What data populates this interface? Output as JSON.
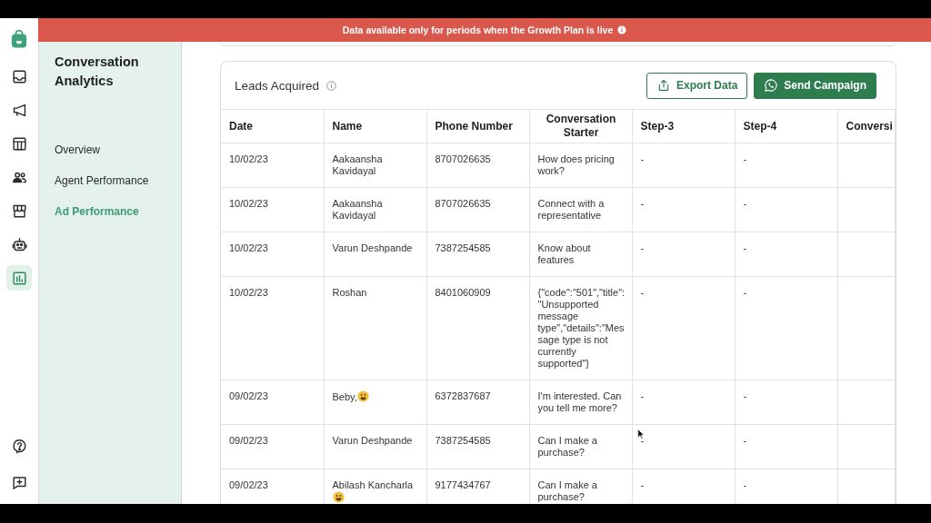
{
  "rail": {
    "items": [
      {
        "selected": false
      },
      {
        "selected": false
      },
      {
        "selected": false
      },
      {
        "selected": false
      },
      {
        "selected": false
      },
      {
        "selected": false
      },
      {
        "selected": true
      }
    ]
  },
  "banner": {
    "text": "Data available only for periods when the Growth Plan is live"
  },
  "sidebar": {
    "title": "Conversation Analytics",
    "items": [
      {
        "label": "Overview",
        "selected": false
      },
      {
        "label": "Agent Performance",
        "selected": false
      },
      {
        "label": "Ad Performance",
        "selected": true
      }
    ]
  },
  "card": {
    "title": "Leads Acquired",
    "buttons": [
      {
        "label": "Export Data",
        "kind": "outline"
      },
      {
        "label": "Send Campaign",
        "kind": "filled"
      }
    ]
  },
  "table": {
    "columns": [
      "Date",
      "Name",
      "Phone Number",
      "Conversation Starter",
      "Step-3",
      "Step-4",
      "Conversi"
    ],
    "rows": [
      {
        "date": "10/02/23",
        "name": "Aakaansha Kavidayal",
        "emoji": false,
        "phone": "8707026635",
        "starter": "How does pricing work?",
        "step_3": "-",
        "step_4": "-"
      },
      {
        "date": "10/02/23",
        "name": "Aakaansha Kavidayal",
        "emoji": false,
        "phone": "8707026635",
        "starter": "Connect with a representative",
        "step_3": "-",
        "step_4": "-"
      },
      {
        "date": "10/02/23",
        "name": "Varun Deshpande",
        "emoji": false,
        "phone": "7387254585",
        "starter": "Know about features",
        "step_3": "-",
        "step_4": "-"
      },
      {
        "date": "10/02/23",
        "name": "Roshan",
        "emoji": false,
        "phone": "8401060909",
        "starter": "{\"code\":\"501\",\"title\":\"Unsupported message type\",\"details\":\"Message type is not currently supported\"}",
        "step_3": "-",
        "step_4": "-"
      },
      {
        "date": "09/02/23",
        "name": "Beby,",
        "emoji": true,
        "phone": "6372837687",
        "starter": "I'm interested. Can you tell me more?",
        "step_3": "-",
        "step_4": "-"
      },
      {
        "date": "09/02/23",
        "name": "Varun Deshpande",
        "emoji": false,
        "phone": "7387254585",
        "starter": "Can I make a purchase?",
        "step_3": "-",
        "step_4": "-"
      },
      {
        "date": "09/02/23",
        "name": "Abilash Kancharla",
        "emoji": true,
        "phone": "9177434767",
        "starter": "Can I make a purchase?",
        "step_3": "-",
        "step_4": "-"
      }
    ]
  }
}
